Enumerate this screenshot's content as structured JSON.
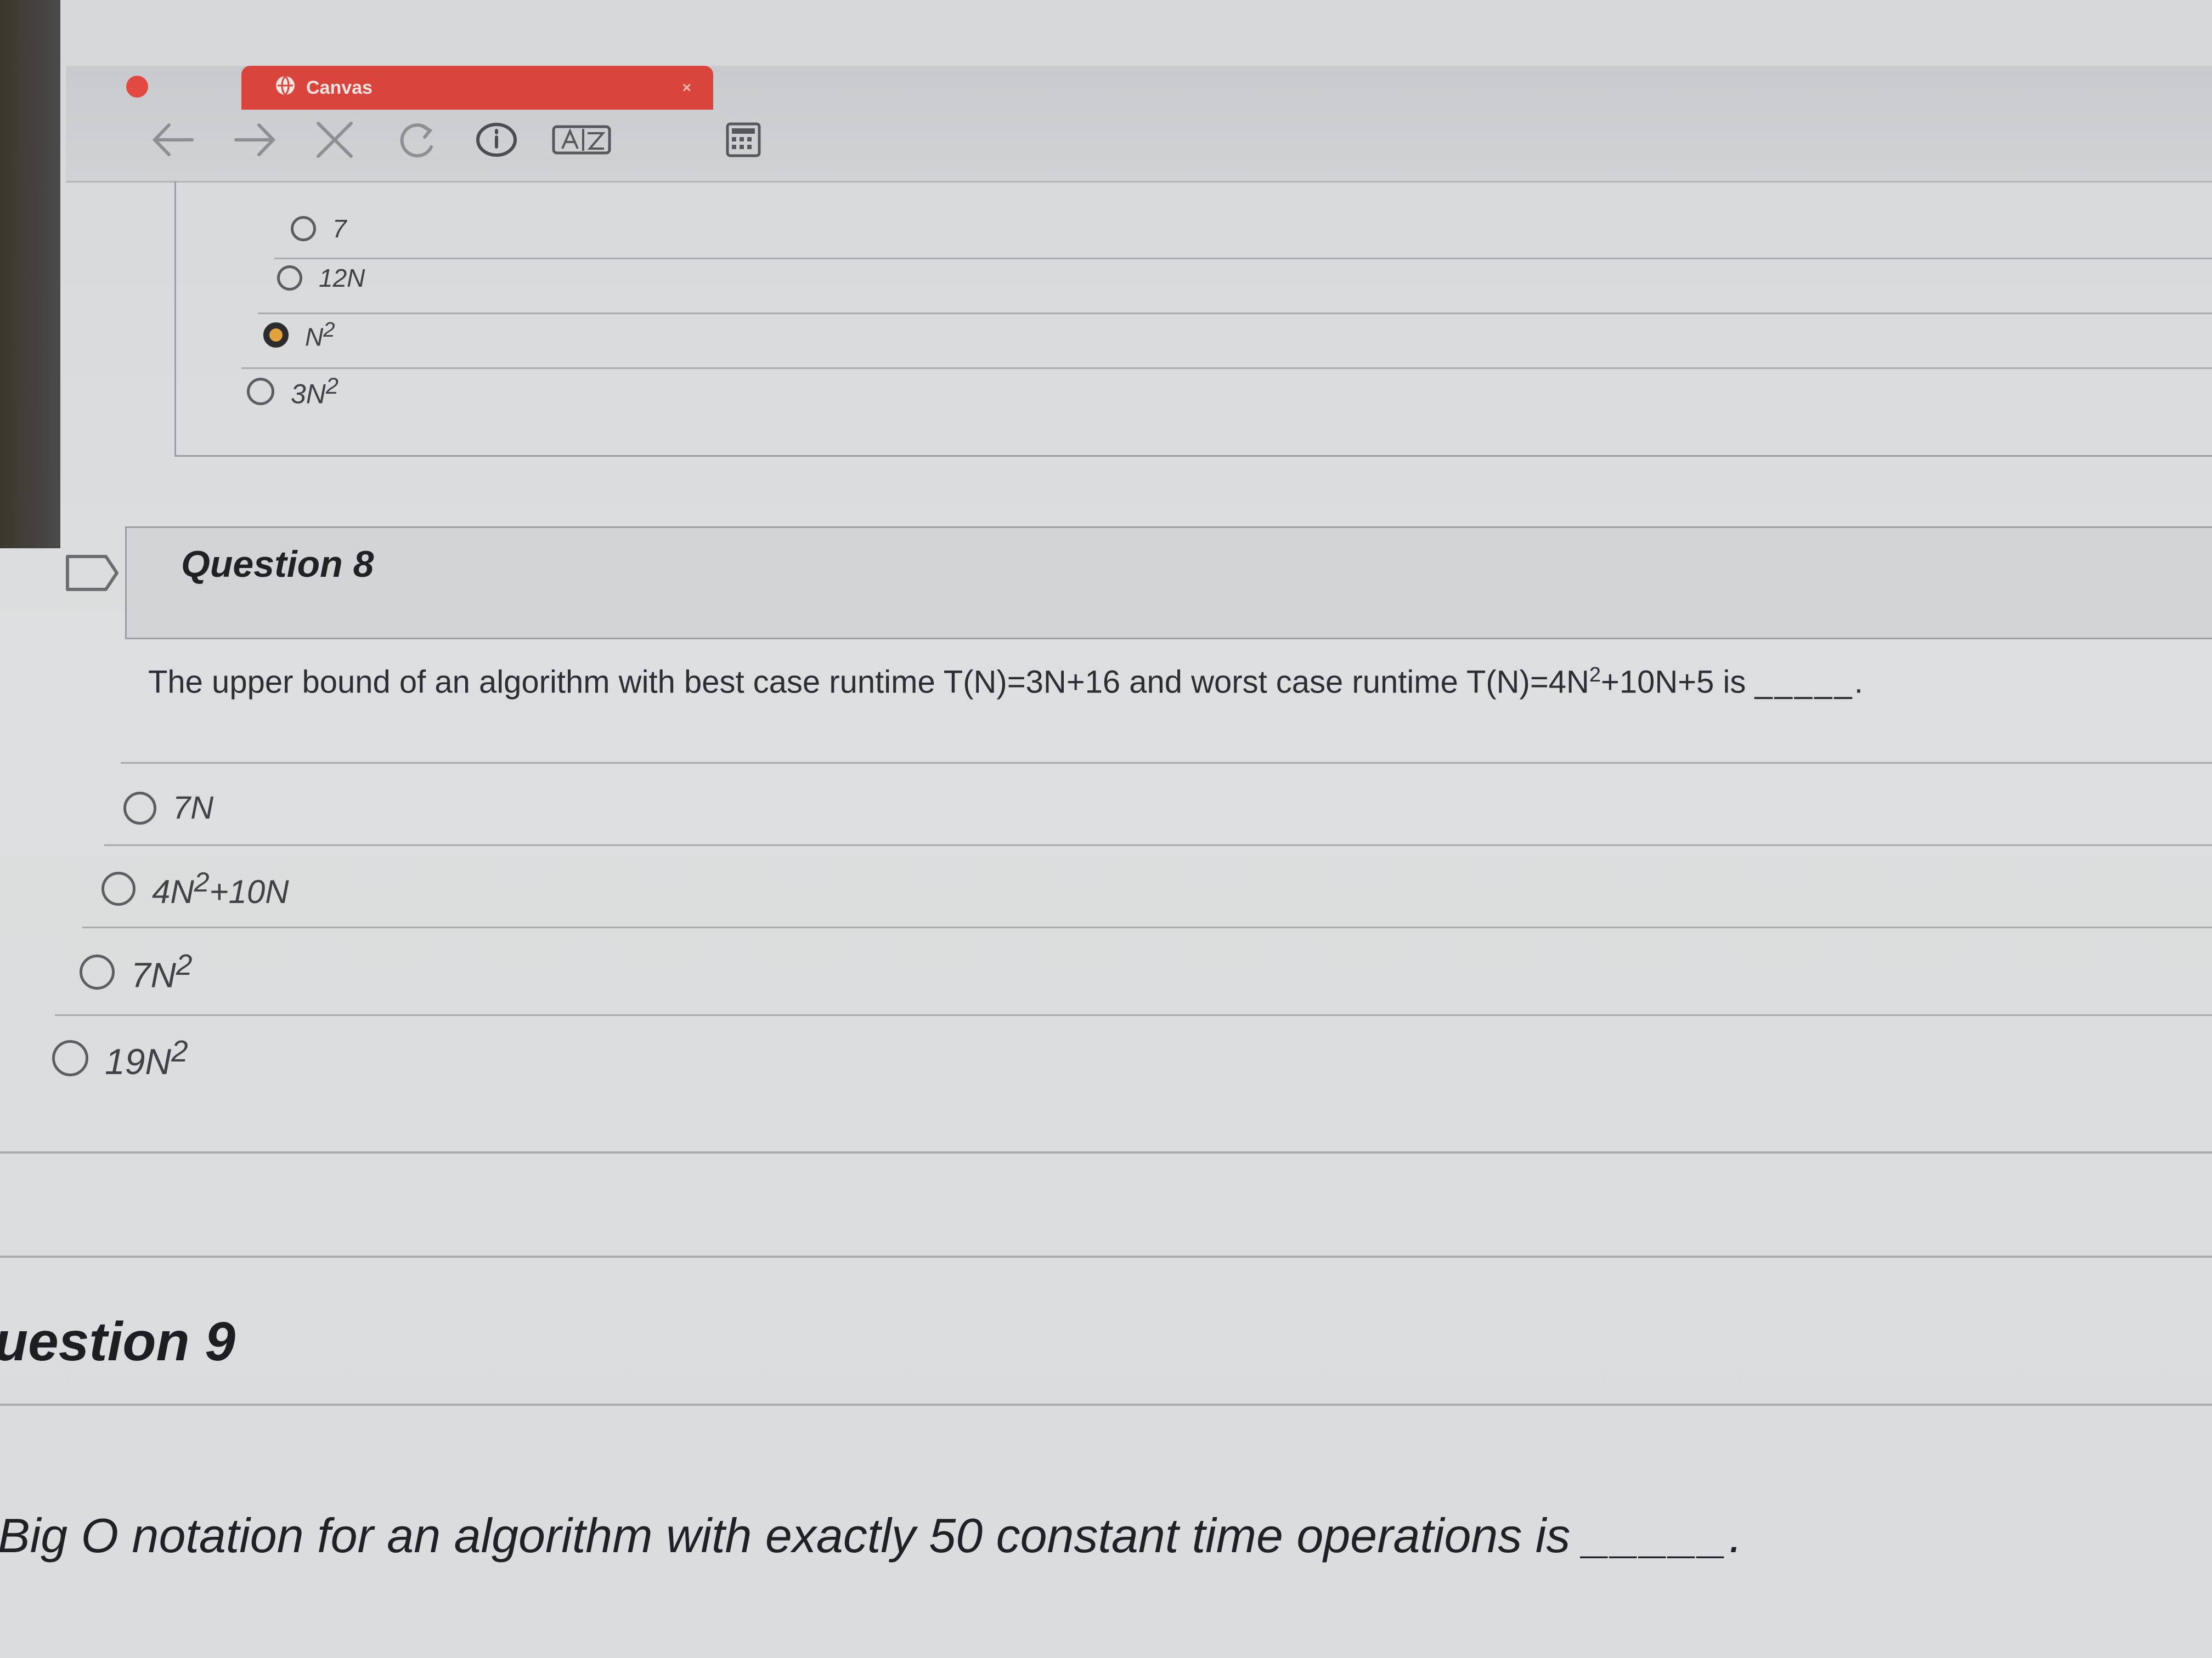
{
  "browser": {
    "tab_title": "Canvas",
    "tab_close": "×",
    "toolbar_buttons": [
      "back-icon",
      "forward-icon",
      "close-icon",
      "reload-icon",
      "info-icon",
      "text-size-icon",
      "calculator-icon"
    ],
    "accent_color": "#d9453c"
  },
  "previous_question": {
    "options": [
      {
        "label": "7",
        "selected": false
      },
      {
        "label": "12N",
        "selected": false
      },
      {
        "label": "N",
        "sup": "2",
        "selected": true
      },
      {
        "label": "3N",
        "sup": "2",
        "selected": false
      }
    ]
  },
  "question8": {
    "title": "Question 8",
    "text_part1": "The upper bound of an algorithm with best case runtime T(N)=3N+16 and worst case runtime T(N)=4N",
    "text_sup": "2",
    "text_part2": "+10N+5 is",
    "blank": "_____.",
    "options": [
      {
        "pre": "7N",
        "sup": "",
        "post": ""
      },
      {
        "pre": "4N",
        "sup": "2",
        "post": "+10N"
      },
      {
        "pre": "7N",
        "sup": "2",
        "post": ""
      },
      {
        "pre": "19N",
        "sup": "2",
        "post": ""
      }
    ]
  },
  "question9": {
    "title": "uestion 9",
    "text": "Big O notation for an algorithm with exactly 50 constant time operations is",
    "blank": "_____."
  }
}
